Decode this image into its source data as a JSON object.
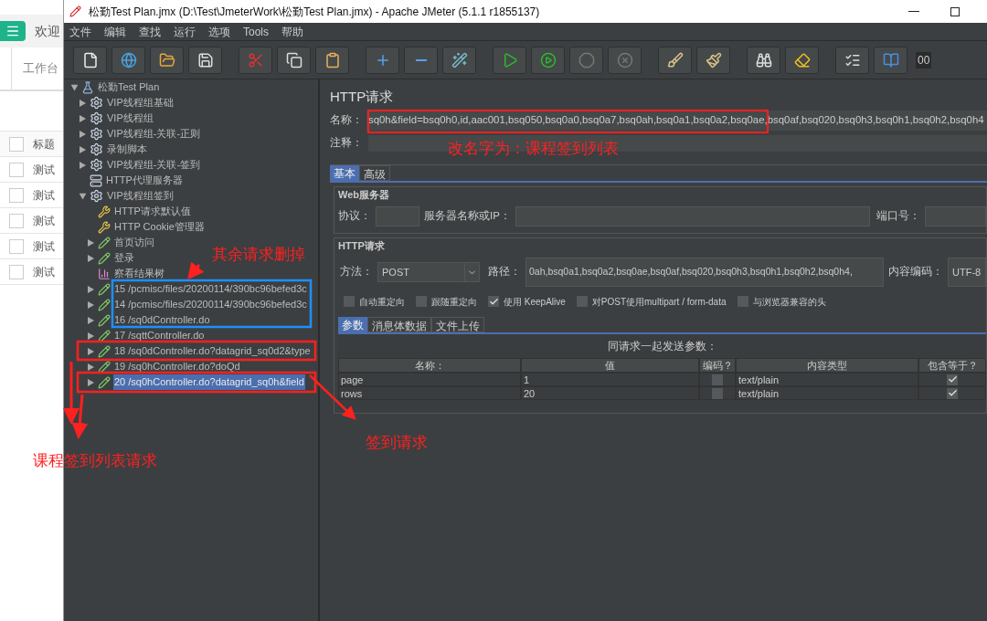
{
  "background_app": {
    "header_text": "欢迎",
    "tab": "工作台",
    "table": {
      "column": "标题",
      "header_checked": false,
      "rows": [
        {
          "title": "测试",
          "checked": false
        },
        {
          "title": "测试",
          "checked": false
        },
        {
          "title": "测试",
          "checked": false
        },
        {
          "title": "测试",
          "checked": false
        },
        {
          "title": "测试",
          "checked": false
        }
      ]
    }
  },
  "window": {
    "title": "松勤Test Plan.jmx (D:\\Test\\JmeterWork\\松勤Test Plan.jmx) - Apache JMeter (5.1.1 r1855137)"
  },
  "menu": [
    "文件",
    "编辑",
    "查找",
    "运行",
    "选项",
    "Tools",
    "帮助"
  ],
  "toolbar": {
    "timer": "00"
  },
  "tree": [
    {
      "label": "松勤Test Plan",
      "kind": "plan",
      "expanded": true,
      "selected": false,
      "children": [
        {
          "label": "VIP线程组基础",
          "kind": "group",
          "expanded": false,
          "selected": false
        },
        {
          "label": "VIP线程组",
          "kind": "group",
          "expanded": false,
          "selected": false
        },
        {
          "label": "VIP线程组-关联-正则",
          "kind": "group",
          "expanded": false,
          "selected": false
        },
        {
          "label": "录制脚本",
          "kind": "group",
          "expanded": false,
          "selected": false
        },
        {
          "label": "VIP线程组-关联-签到",
          "kind": "group",
          "expanded": false,
          "selected": false
        },
        {
          "label": "HTTP代理服务器",
          "kind": "proxy",
          "selected": false
        },
        {
          "label": "VIP线程组签到",
          "kind": "group",
          "expanded": true,
          "selected": false,
          "children": [
            {
              "label": "HTTP请求默认值",
              "kind": "config",
              "selected": false
            },
            {
              "label": "HTTP Cookie管理器",
              "kind": "config",
              "selected": false
            },
            {
              "label": "首页访问",
              "kind": "sampler",
              "expanded": false,
              "selected": false
            },
            {
              "label": "登录",
              "kind": "sampler",
              "expanded": false,
              "selected": false
            },
            {
              "label": "察看结果树",
              "kind": "listener",
              "selected": false
            },
            {
              "label": "15 /pcmisc/files/20200114/390bc96befed3c",
              "kind": "sampler",
              "expanded": false,
              "selected": false
            },
            {
              "label": "14 /pcmisc/files/20200114/390bc96befed3c",
              "kind": "sampler",
              "expanded": false,
              "selected": false
            },
            {
              "label": "16 /sq0dController.do",
              "kind": "sampler",
              "expanded": false,
              "selected": false
            },
            {
              "label": "17 /sqttController.do",
              "kind": "sampler",
              "expanded": false,
              "selected": false
            },
            {
              "label": "18 /sq0dController.do?datagrid_sq0d2&type",
              "kind": "sampler",
              "expanded": false,
              "selected": false
            },
            {
              "label": "19 /sq0hController.do?doQd",
              "kind": "sampler",
              "expanded": false,
              "selected": false
            },
            {
              "label": "20 /sq0hController.do?datagrid_sq0h&field",
              "kind": "sampler",
              "expanded": false,
              "selected": true
            }
          ]
        }
      ]
    }
  ],
  "panel": {
    "title": "HTTP请求",
    "name": {
      "label": "名称：",
      "value": "sq0h&field=bsq0h0,id,aac001,bsq050,bsq0a0,bsq0a7,bsq0ah,bsq0a1,bsq0a2,bsq0ae,bsq0af,bsq020,bsq0h3,bsq0h1,bsq0h2,bsq0h4"
    },
    "comment": {
      "label": "注释："
    },
    "tabs": [
      {
        "label": "基本",
        "selected": true
      },
      {
        "label": "高级",
        "selected": false
      }
    ],
    "web_server": {
      "title": "Web服务器",
      "protocol_label": "协议：",
      "server_label": "服务器名称或IP：",
      "port_label": "端口号："
    },
    "http_request": {
      "title": "HTTP请求",
      "method_label": "方法：",
      "method": "POST",
      "path_label": "路径：",
      "path": "0ah,bsq0a1,bsq0a2,bsq0ae,bsq0af,bsq020,bsq0h3,bsq0h1,bsq0h2,bsq0h4,",
      "encoding_label": "内容编码：",
      "encoding": "UTF-8",
      "options": [
        {
          "label": "自动重定向",
          "checked": false
        },
        {
          "label": "跟随重定向",
          "checked": false
        },
        {
          "label": "使用 KeepAlive",
          "checked": true
        },
        {
          "label": "对POST使用multipart / form-data",
          "checked": false
        },
        {
          "label": "与浏览器兼容的头",
          "checked": false
        }
      ]
    },
    "param_tabs": [
      {
        "label": "参数",
        "selected": true
      },
      {
        "label": "消息体数据",
        "selected": false
      },
      {
        "label": "文件上传",
        "selected": false
      }
    ],
    "params": {
      "caption": "同请求一起发送参数：",
      "columns": [
        "名称：",
        "值",
        "编码？",
        "内容类型",
        "包含等于？"
      ],
      "rows": [
        {
          "name": "page",
          "value": "1",
          "encode": false,
          "type": "text/plain",
          "include_equals": true
        },
        {
          "name": "rows",
          "value": "20",
          "encode": false,
          "type": "text/plain",
          "include_equals": true
        }
      ]
    }
  },
  "annotations": {
    "delete_note": "其余请求删掉",
    "rename_note": "改名字为：课程签到列表",
    "list_request_note": "课程签到列表请求",
    "sign_request_note": "签到请求"
  }
}
